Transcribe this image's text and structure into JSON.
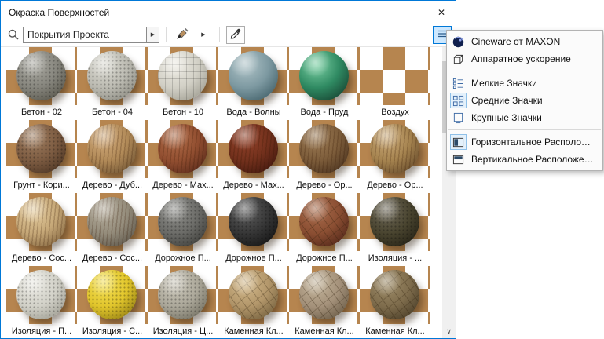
{
  "window": {
    "title": "Окраска Поверхностей",
    "close_glyph": "✕"
  },
  "toolbar": {
    "search_value": "Покрытия Проекта",
    "search_expand_glyph": "▶",
    "paint_dropdown_glyph": "▶"
  },
  "scrollbar": {
    "up_glyph": "∧",
    "down_glyph": "∨"
  },
  "materials": [
    {
      "label": "Бетон - 02",
      "colors": [
        "#aaa9a1",
        "#87867e",
        "#565449"
      ],
      "speckle": true
    },
    {
      "label": "Бетон - 04",
      "colors": [
        "#dcdbd3",
        "#bcbbb2",
        "#8b8a80"
      ],
      "speckle": true
    },
    {
      "label": "Бетон - 10",
      "colors": [
        "#edebe3",
        "#d2d0c6",
        "#9c9a8e"
      ],
      "tiles": true
    },
    {
      "label": "Вода - Волны",
      "colors": [
        "#b0c4c8",
        "#7d99a1",
        "#3e5d66"
      ]
    },
    {
      "label": "Вода - Пруд",
      "colors": [
        "#7cd0a4",
        "#2f8a62",
        "#153f2e"
      ]
    },
    {
      "label": "Воздух",
      "sphere": false,
      "colors": []
    },
    {
      "label": "Грунт - Кори...",
      "colors": [
        "#a07e60",
        "#7d5c42",
        "#4a3322"
      ],
      "speckle": true
    },
    {
      "label": "Дерево - Дуб...",
      "colors": [
        "#d2ab7c",
        "#b18a58",
        "#6d5232"
      ],
      "stripes": true
    },
    {
      "label": "Дерево - Мах...",
      "colors": [
        "#b26e4a",
        "#914e30",
        "#58291a"
      ],
      "stripes": true
    },
    {
      "label": "Дерево - Мах...",
      "colors": [
        "#93422a",
        "#72301c",
        "#40170e"
      ],
      "stripes": true
    },
    {
      "label": "Дерево - Ор...",
      "colors": [
        "#9d7c55",
        "#7c5c3a",
        "#48311e"
      ],
      "stripes": true
    },
    {
      "label": "Дерево - Ор...",
      "colors": [
        "#cbaa78",
        "#a5834f",
        "#64492a"
      ],
      "stripes": true
    },
    {
      "label": "Дерево - Сос...",
      "colors": [
        "#e3cb9e",
        "#c6a878",
        "#83653f"
      ],
      "stripes": true
    },
    {
      "label": "Дерево - Сос...",
      "colors": [
        "#b3ab9a",
        "#948c7b",
        "#5b5448"
      ],
      "stripes": true
    },
    {
      "label": "Дорожное П...",
      "colors": [
        "#90908c",
        "#6c6c68",
        "#3c3c38"
      ],
      "speckle": true
    },
    {
      "label": "Дорожное П...",
      "colors": [
        "#606060",
        "#363636",
        "#121212"
      ],
      "speckle": true
    },
    {
      "label": "Дорожное П...",
      "colors": [
        "#a96c4c",
        "#8a4e32",
        "#4e2418"
      ],
      "cracks": true
    },
    {
      "label": "Изоляция - ...",
      "colors": [
        "#6e6858",
        "#49442f",
        "#232014"
      ],
      "speckle": true
    },
    {
      "label": "Изоляция - П...",
      "colors": [
        "#eae9e2",
        "#d2d1c8",
        "#9c9b90"
      ],
      "speckle": true
    },
    {
      "label": "Изоляция - С...",
      "colors": [
        "#f2df55",
        "#e2c62c",
        "#907c12"
      ],
      "speckle": true
    },
    {
      "label": "Изоляция - Ц...",
      "colors": [
        "#cbc7ba",
        "#aca89a",
        "#6f6c5e"
      ],
      "speckle": true
    },
    {
      "label": "Каменная Кл...",
      "colors": [
        "#d2b88a",
        "#b2966a",
        "#705d3b"
      ],
      "cracks": true
    },
    {
      "label": "Каменная Кл...",
      "colors": [
        "#c3b49a",
        "#a4917a",
        "#665843"
      ],
      "cracks": true
    },
    {
      "label": "Каменная Кл...",
      "colors": [
        "#9e8c68",
        "#7e6c4c",
        "#473b26"
      ],
      "cracks": true
    }
  ],
  "menu": {
    "items": [
      {
        "label": "Cineware от MAXON",
        "icon": "cineware-icon"
      },
      {
        "label": "Аппаратное ускорение",
        "icon": "hardware-acceleration-icon"
      },
      {
        "separator": true
      },
      {
        "label": "Мелкие Значки",
        "icon": "small-icons-icon"
      },
      {
        "label": "Средние Значки",
        "icon": "medium-icons-icon",
        "selected": true
      },
      {
        "label": "Крупные Значки",
        "icon": "large-icons-icon"
      },
      {
        "separator": true
      },
      {
        "label": "Горизонтальное Расположение",
        "icon": "horizontal-layout-icon",
        "selected": true
      },
      {
        "label": "Вертикальное Расположение",
        "icon": "vertical-layout-icon"
      }
    ]
  },
  "colors": {
    "accent": "#0078d7",
    "checker_brown": "#b6854f",
    "checker_light": "#ffffff"
  }
}
